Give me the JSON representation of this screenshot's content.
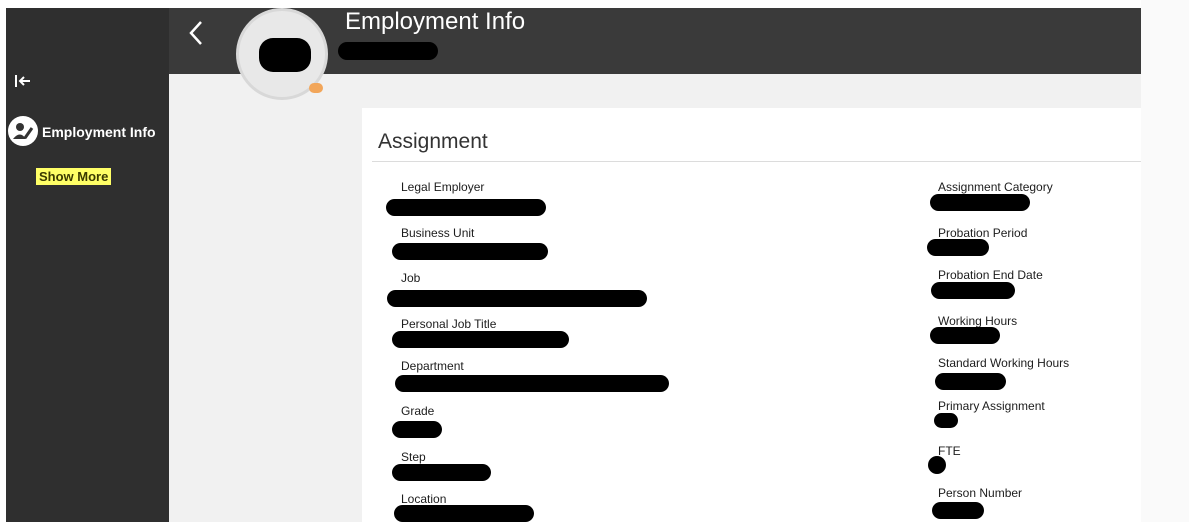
{
  "sidebar": {
    "collapse_icon": "collapse-left-icon",
    "item_label": "Employment Info",
    "show_more_label": "Show More"
  },
  "header": {
    "back_icon": "chevron-left-icon",
    "title": "Employment Info"
  },
  "card": {
    "title": "Assignment",
    "left_fields": [
      {
        "label": "Legal Employer"
      },
      {
        "label": "Business Unit"
      },
      {
        "label": "Job"
      },
      {
        "label": "Personal Job Title"
      },
      {
        "label": "Department"
      },
      {
        "label": "Grade"
      },
      {
        "label": "Step"
      },
      {
        "label": "Location"
      }
    ],
    "right_fields": [
      {
        "label": "Assignment Category"
      },
      {
        "label": "Probation Period"
      },
      {
        "label": "Probation End Date"
      },
      {
        "label": "Working Hours"
      },
      {
        "label": "Standard Working Hours"
      },
      {
        "label": "Primary Assignment"
      },
      {
        "label": "FTE"
      },
      {
        "label": "Person Number"
      }
    ]
  },
  "colors": {
    "sidebar_bg": "#2f2f2f",
    "header_bg": "#3a3a3a",
    "highlight": "#ffff66"
  }
}
